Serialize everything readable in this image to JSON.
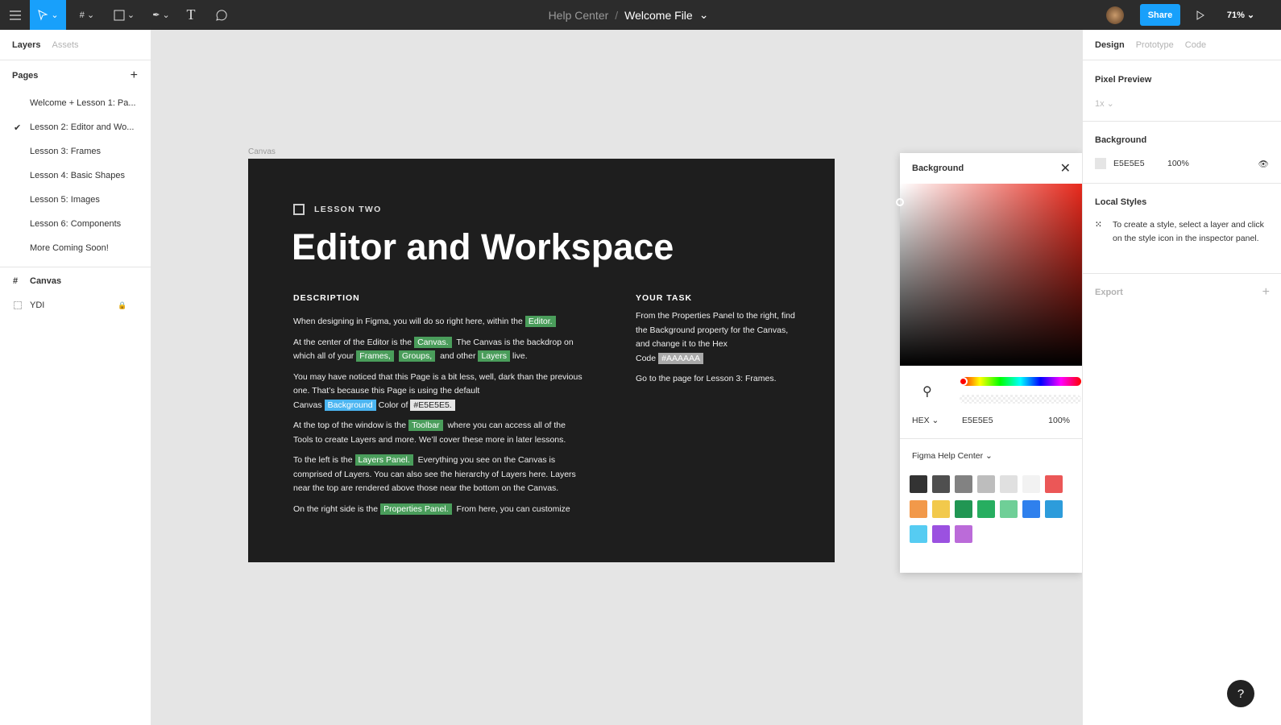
{
  "toolbar": {
    "breadcrumb_parent": "Help Center",
    "separator": "/",
    "file_name": "Welcome File",
    "share": "Share",
    "zoom": "71%",
    "accent": "#18a0fb"
  },
  "left": {
    "tabs": [
      "Layers",
      "Assets"
    ],
    "pages_title": "Pages",
    "pages": [
      "Welcome + Lesson 1: Pa...",
      "Lesson 2: Editor and Wo...",
      "Lesson 3: Frames",
      "Lesson 4: Basic Shapes",
      "Lesson 5: Images",
      "Lesson 6: Components",
      "More Coming Soon!"
    ],
    "current_page_check": "✔",
    "layers": [
      "Canvas",
      "YDI"
    ]
  },
  "canvas": {
    "frame_label": "Canvas",
    "eyebrow": "LESSON TWO",
    "title": "Editor and Workspace",
    "desc_heading": "DESCRIPTION",
    "task_heading": "YOUR TASK",
    "paragraphs": [
      [
        {
          "t": "When designing in Figma, you will do so right here, within the"
        },
        {
          "t": "Editor.",
          "hl": "green"
        }
      ],
      [
        {
          "t": "At the center of the Editor is the"
        },
        {
          "t": "Canvas.",
          "hl": "green"
        },
        {
          "t": " The Canvas is the backdrop on which all of your"
        },
        {
          "t": "Frames,",
          "hl": "green"
        },
        {
          "t": "Groups,",
          "hl": "green"
        },
        {
          "t": " and other"
        },
        {
          "t": "Layers",
          "hl": "green"
        },
        {
          "t": "live."
        }
      ],
      [
        {
          "t": "You may have noticed that this Page is a bit less, well, dark than the previous one. That’s because this Page is using the default Canvas"
        },
        {
          "t": "Background",
          "hl": "blue"
        },
        {
          "t": "Color of"
        },
        {
          "t": "#E5E5E5.",
          "hl": "grey"
        }
      ],
      [
        {
          "t": "At the top of  the window is the"
        },
        {
          "t": "Toolbar",
          "hl": "green"
        },
        {
          "t": " where you can access all of the Tools to create Layers and more. We’ll cover these more in later lessons."
        }
      ],
      [
        {
          "t": "To the left is the"
        },
        {
          "t": "Layers Panel.",
          "hl": "green"
        },
        {
          "t": " Everything you see on the Canvas is comprised of Layers. You can also see the hierarchy of Layers here. Layers near the top are rendered above those near the bottom on the Canvas."
        }
      ],
      [
        {
          "t": "On the right side is the"
        },
        {
          "t": "Properties Panel.",
          "hl": "green"
        },
        {
          "t": " From here, you can customize"
        }
      ]
    ],
    "task": [
      [
        {
          "t": "From the Properties Panel to the right, find the Background property for the Canvas, and change it to the Hex Code"
        },
        {
          "t": "#AAAAAA",
          "hl": "dgrey"
        }
      ],
      [
        {
          "t": "Go to the page for Lesson 3: Frames."
        }
      ]
    ]
  },
  "picker": {
    "title": "Background",
    "mode": "HEX",
    "hex": "E5E5E5",
    "opacity": "100%",
    "library": "Figma Help Center",
    "swatches": [
      "#333333",
      "#4f4f4f",
      "#828282",
      "#bdbdbd",
      "#e0e0e0",
      "#f2f2f2",
      "#eb5757",
      "#f2994a",
      "#f2c94c",
      "#219653",
      "#27ae60",
      "#6fcf97",
      "#2f80ed",
      "#2d9cdb",
      "#56ccf2",
      "#9b51e0",
      "#bb6bd9"
    ]
  },
  "right": {
    "tabs": [
      "Design",
      "Prototype",
      "Code"
    ],
    "pixel_preview": "Pixel Preview",
    "pixel_value": "1x",
    "background": "Background",
    "bg_hex": "E5E5E5",
    "bg_opacity": "100%",
    "local_styles": "Local Styles",
    "local_styles_text": "To create a style, select a layer and click on the style icon in the inspector panel.",
    "export": "Export"
  },
  "help": "?"
}
